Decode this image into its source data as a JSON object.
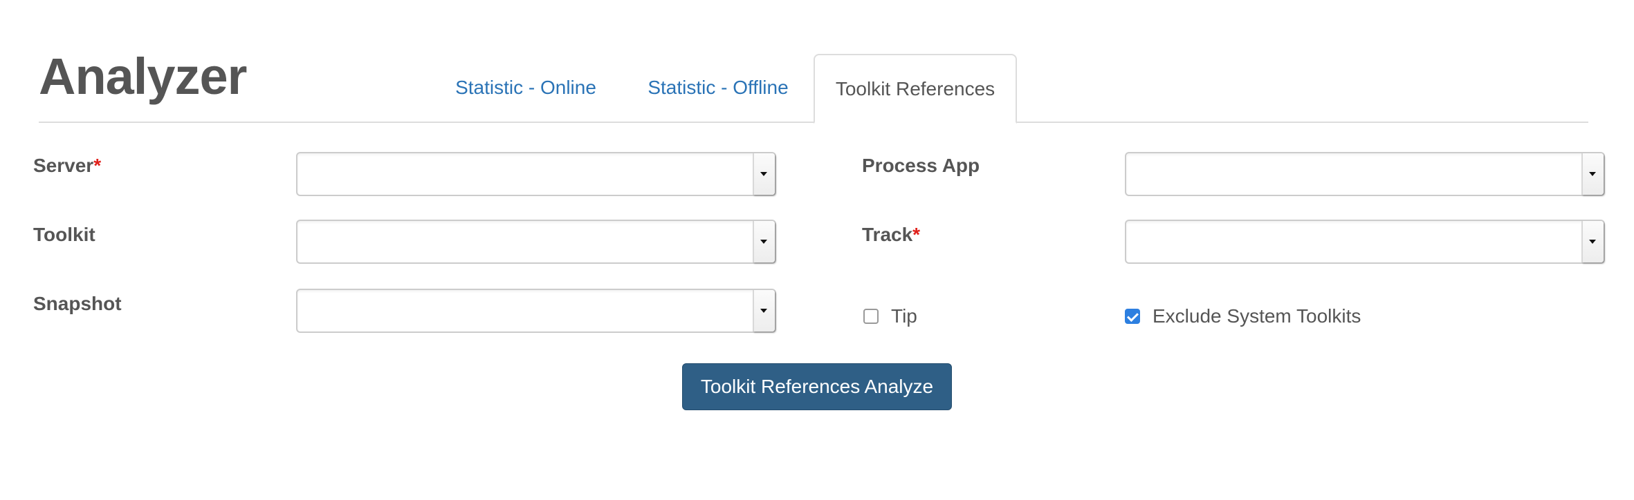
{
  "header": {
    "title": "Analyzer"
  },
  "tabs": [
    {
      "label": "Statistic - Online",
      "active": false
    },
    {
      "label": "Statistic - Offline",
      "active": false
    },
    {
      "label": "Toolkit References",
      "active": true
    }
  ],
  "form": {
    "server": {
      "label": "Server",
      "required_mark": "*",
      "value": ""
    },
    "toolkit": {
      "label": "Toolkit",
      "value": ""
    },
    "snapshot": {
      "label": "Snapshot",
      "value": ""
    },
    "process_app": {
      "label": "Process App",
      "value": ""
    },
    "track": {
      "label": "Track",
      "required_mark": "*",
      "value": ""
    },
    "tip": {
      "label": "Tip",
      "checked": false
    },
    "exclude_system_toolkits": {
      "label": "Exclude System Toolkits",
      "checked": true
    }
  },
  "actions": {
    "analyze_label": "Toolkit References Analyze"
  },
  "colors": {
    "tab_link": "#2a73b6",
    "button_bg": "#2f5f86",
    "required": "#e0201b",
    "checkbox_checked": "#2d7fe0"
  }
}
